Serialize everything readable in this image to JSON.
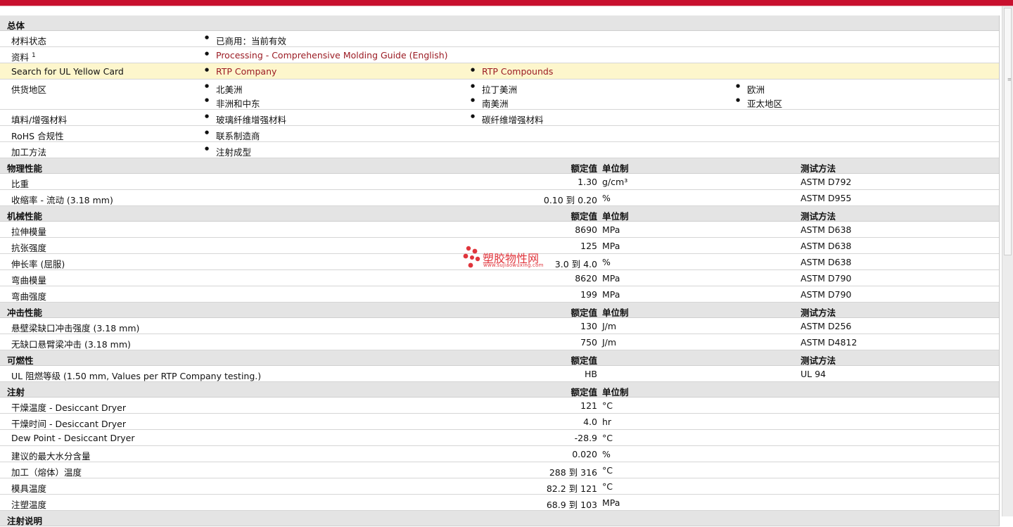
{
  "general": {
    "title": "总体",
    "status_label": "材料状态",
    "status_value": "已商用：当前有效",
    "resources_label": "资料",
    "resources_sup": "1",
    "resources_link": "Processing - Comprehensive Molding Guide (English)",
    "ul_label": "Search for UL Yellow Card",
    "ul_link1": "RTP Company",
    "ul_link2": "RTP Compounds",
    "supply_label": "供货地区",
    "supply": [
      "北美洲",
      "拉丁美洲",
      "欧洲",
      "非洲和中东",
      "南美洲",
      "亚太地区"
    ],
    "filler_label": "填料/增强材料",
    "filler1": "玻璃纤维增强材料",
    "filler2": "碳纤维增强材料",
    "rohs_label": "RoHS 合规性",
    "rohs_value": "联系制造商",
    "processing_label": "加工方法",
    "processing_value": "注射成型"
  },
  "headers": {
    "nominal": "额定值",
    "unit": "单位制",
    "test": "测试方法"
  },
  "physical": {
    "title": "物理性能",
    "rows": [
      {
        "name": "比重",
        "value": "1.30",
        "unit": "g/cm³",
        "test": "ASTM D792"
      },
      {
        "name": "收缩率  - 流动  (3.18 mm)",
        "value": "0.10 到  0.20",
        "unit": "%",
        "test": "ASTM D955"
      }
    ]
  },
  "mechanical": {
    "title": "机械性能",
    "rows": [
      {
        "name": "拉伸模量",
        "value": "8690",
        "unit": "MPa",
        "test": "ASTM D638"
      },
      {
        "name": "抗张强度",
        "value": "125",
        "unit": "MPa",
        "test": "ASTM D638"
      },
      {
        "name": "伸长率  (屈服)",
        "value": "3.0 到  4.0",
        "unit": "%",
        "test": "ASTM D638"
      },
      {
        "name": "弯曲模量",
        "value": "8620",
        "unit": "MPa",
        "test": "ASTM D790"
      },
      {
        "name": "弯曲强度",
        "value": "199",
        "unit": "MPa",
        "test": "ASTM D790"
      }
    ]
  },
  "impact": {
    "title": "冲击性能",
    "rows": [
      {
        "name": "悬壁梁缺口冲击强度  (3.18 mm)",
        "value": "130",
        "unit": "J/m",
        "test": "ASTM D256"
      },
      {
        "name": "无缺口悬臂梁冲击  (3.18 mm)",
        "value": "750",
        "unit": "J/m",
        "test": "ASTM D4812"
      }
    ]
  },
  "flammability": {
    "title": "可燃性",
    "rows": [
      {
        "name": "UL 阻燃等级  (1.50 mm, Values per RTP Company testing.)",
        "value": "HB",
        "unit": "",
        "test": "UL 94"
      }
    ]
  },
  "injection": {
    "title": "注射",
    "rows": [
      {
        "name": "干燥温度  - Desiccant Dryer",
        "value": "121",
        "unit": "°C"
      },
      {
        "name": "干燥时间  - Desiccant Dryer",
        "value": "4.0",
        "unit": "hr"
      },
      {
        "name": "Dew Point - Desiccant Dryer",
        "value": "-28.9",
        "unit": "°C"
      },
      {
        "name": "建议的最大水分含量",
        "value": "0.020",
        "unit": "%"
      },
      {
        "name": "加工（熔体）温度",
        "value": "288 到  316",
        "unit": "°C"
      },
      {
        "name": "模具温度",
        "value": "82.2 到  121",
        "unit": "°C"
      },
      {
        "name": "注塑温度",
        "value": "68.9 到  103",
        "unit": "MPa"
      }
    ]
  },
  "injection_notes": {
    "title": "注射说明"
  },
  "watermark": {
    "name": "塑胶物性网",
    "url": "www.sujiaowuxing.com"
  },
  "colors": {
    "brand_red": "#c8102e",
    "link": "#9b1b23",
    "highlight": "#fdf6cc",
    "section_header": "#e4e4e4"
  }
}
